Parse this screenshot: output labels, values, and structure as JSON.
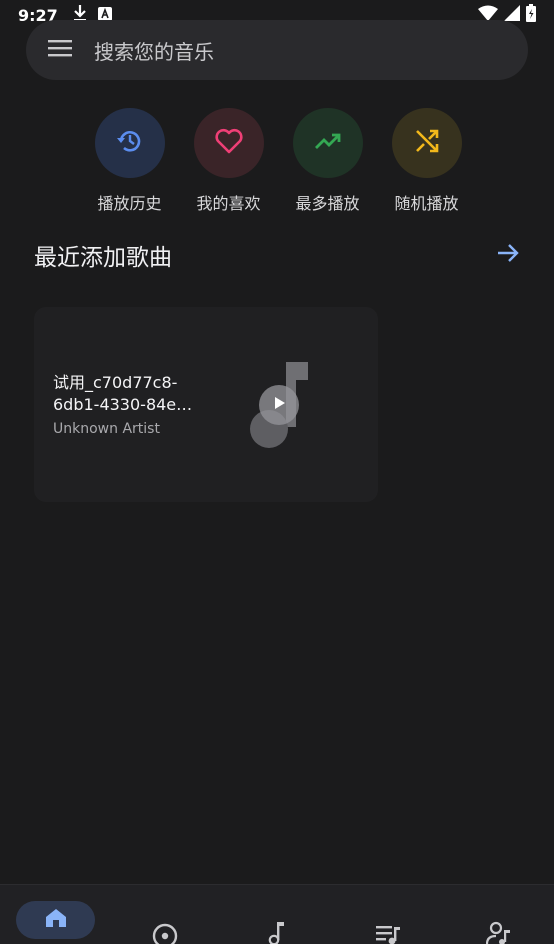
{
  "status_bar": {
    "time": "9:27",
    "left_icons": [
      "download-icon",
      "a-icon"
    ],
    "right_icons": [
      "wifi-icon",
      "signal-icon",
      "battery-icon"
    ]
  },
  "search": {
    "placeholder": "搜索您的音乐",
    "menu_icon": "menu-icon"
  },
  "quick_actions": [
    {
      "label": "播放历史",
      "icon": "history-icon",
      "color": "#5b8def",
      "bg": "#253048"
    },
    {
      "label": "我的喜欢",
      "icon": "heart-icon",
      "color": "#ef3f76",
      "bg": "#3a2428"
    },
    {
      "label": "最多播放",
      "icon": "trending-up-icon",
      "color": "#34a853",
      "bg": "#1f3326"
    },
    {
      "label": "随机播放",
      "icon": "shuffle-icon",
      "color": "#f2b81b",
      "bg": "#37321e"
    }
  ],
  "recent_section": {
    "title": "最近添加歌曲",
    "arrow_icon": "arrow-right-icon",
    "accent": "#8ab4f8"
  },
  "songs": [
    {
      "title": "试用_c70d77c8-6db1-4330-84e…",
      "artist": "Unknown Artist"
    }
  ],
  "bottom_nav": {
    "items": [
      "home-icon",
      "album-icon",
      "music-note-icon",
      "playlist-icon",
      "artist-icon"
    ],
    "active": "home-icon",
    "active_color": "#8ab4f8"
  }
}
